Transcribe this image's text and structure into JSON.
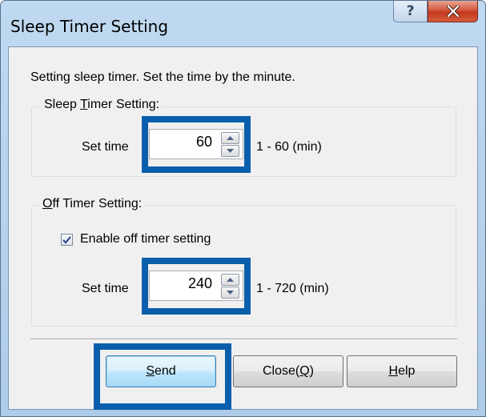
{
  "window": {
    "title": "Sleep Timer Setting",
    "help_caption": "?"
  },
  "intro_text": "Setting sleep timer. Set the time by the minute.",
  "sleep_timer": {
    "group_title_before": "Sleep ",
    "group_title_mnemonic": "T",
    "group_title_after": "imer Setting:",
    "set_time_label": "Set time",
    "value": "60",
    "range": "1 - 60 (min)"
  },
  "off_timer": {
    "group_title_mnemonic": "O",
    "group_title_after": "ff Timer Setting:",
    "checkbox_label": "Enable off timer setting",
    "checked": true,
    "set_time_label": "Set time",
    "value": "240",
    "range": "1 - 720 (min)"
  },
  "buttons": {
    "send_mnemonic": "S",
    "send_rest": "end",
    "close_before": "Close(",
    "close_mnemonic": "Q",
    "close_after": ")",
    "help_mnemonic": "H",
    "help_rest": "elp"
  },
  "colors": {
    "highlight": "#0a5fac",
    "titlebar": "#bfd9f1",
    "client": "#f0f0f0"
  }
}
